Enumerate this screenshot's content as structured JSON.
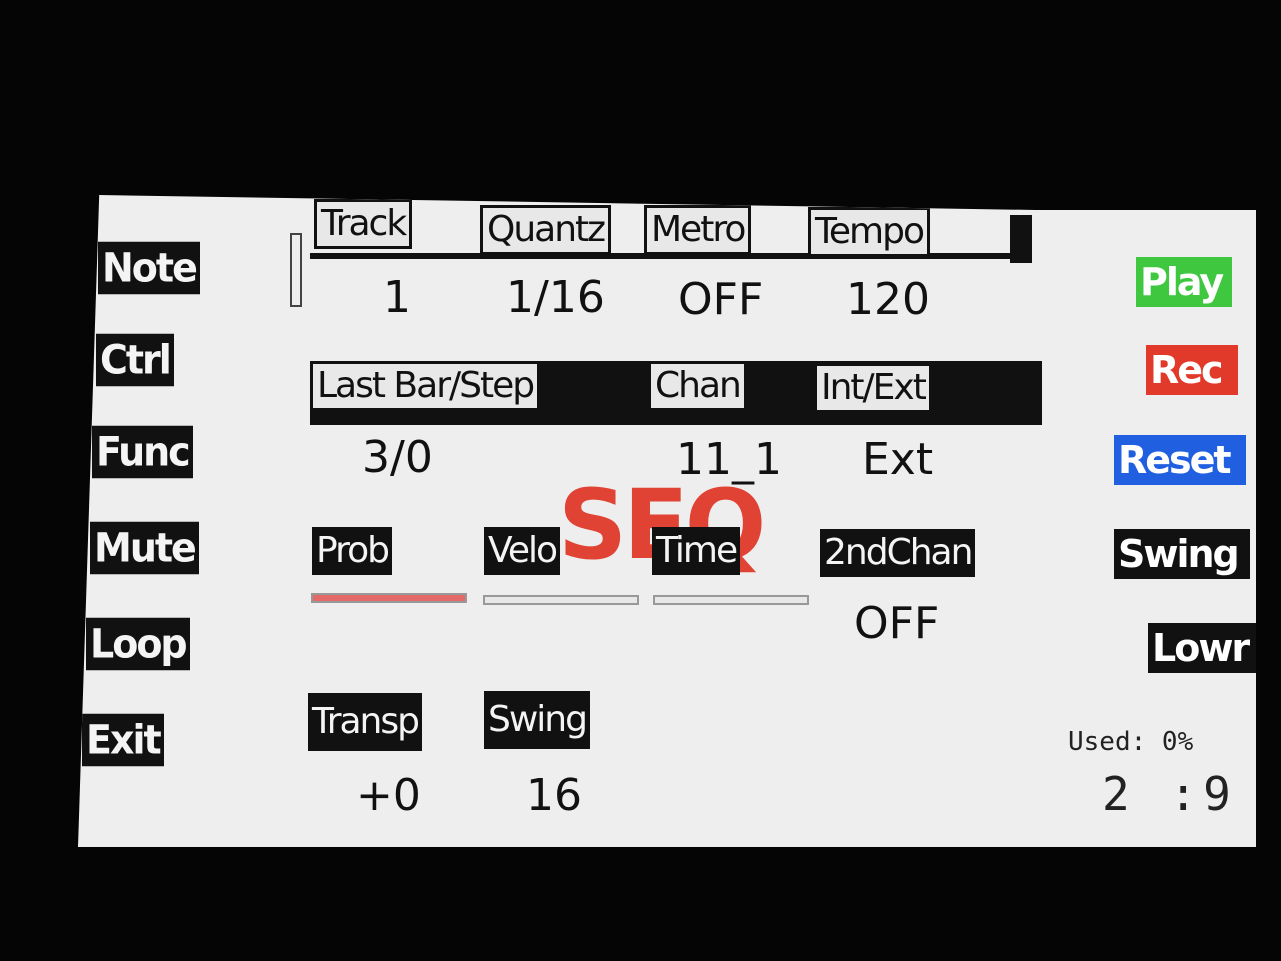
{
  "left_menu": [
    {
      "label": "Note"
    },
    {
      "label": "Ctrl"
    },
    {
      "label": "Func"
    },
    {
      "label": "Mute"
    },
    {
      "label": "Loop"
    },
    {
      "label": "Exit"
    }
  ],
  "row1": {
    "headers": [
      "Track",
      "Quantz",
      "Metro",
      "Tempo"
    ],
    "values": [
      "1",
      "1/16",
      "OFF",
      "120"
    ]
  },
  "row2": {
    "headers": [
      "Last Bar/Step",
      "Chan",
      "Int/Ext"
    ],
    "values": [
      "3/0",
      "11_1",
      "Ext"
    ]
  },
  "overlay_text": "SEQ",
  "row3": {
    "headers": [
      "Prob",
      "Velo",
      "Time",
      "2ndChan"
    ],
    "bars": [
      {
        "level": 1.0,
        "color": "#e46a6a"
      },
      {
        "level": 0.0,
        "color": "#e8e8e8"
      },
      {
        "level": 0.0,
        "color": "#e8e8e8"
      }
    ],
    "second_chan_value": "OFF"
  },
  "row4": {
    "headers": [
      "Transp",
      "Swing"
    ],
    "values": [
      "+0",
      "16"
    ]
  },
  "right_buttons": [
    {
      "label": "Play",
      "bg": "#3fc83f"
    },
    {
      "label": "Rec",
      "bg": "#e23a2a"
    },
    {
      "label": "Reset",
      "bg": "#1f5fe0"
    },
    {
      "label": "Swing",
      "bg": "#111111"
    },
    {
      "label": "Lowr",
      "bg": "#111111"
    }
  ],
  "status": {
    "used": "Used: 0%",
    "position": "2 :9"
  }
}
